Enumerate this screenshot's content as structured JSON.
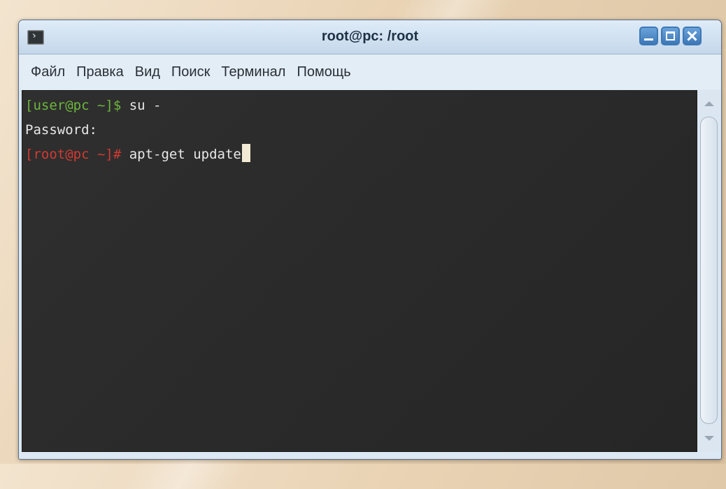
{
  "window": {
    "title": "root@pc: /root"
  },
  "menu": [
    "Файл",
    "Правка",
    "Вид",
    "Поиск",
    "Терминал",
    "Помощь"
  ],
  "terminal": {
    "lines": [
      {
        "prompt": "[user@pc ~]$",
        "prompt_color": "#6db73c",
        "text": " su -"
      },
      {
        "prompt": "",
        "prompt_color": "",
        "text": "Password:"
      },
      {
        "prompt": "[root@pc ~]#",
        "prompt_color": "#d23b32",
        "text": " apt-get update"
      }
    ]
  },
  "colors": {
    "titlebar": "#c4d7ea",
    "terminal_bg": "#2b2b2b",
    "accent_button": "#3d78b7"
  },
  "icons": {
    "app": "terminal-icon",
    "minimize": "minimize-icon",
    "maximize": "maximize-icon",
    "close": "close-icon"
  }
}
